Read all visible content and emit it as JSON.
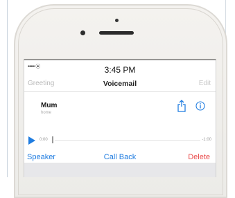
{
  "status_bar": {
    "signal": "••••• ⦿",
    "time": "3:45 PM"
  },
  "nav": {
    "left": "Greeting",
    "title": "Voicemail",
    "right": "Edit"
  },
  "voicemail": {
    "name": "Mum",
    "label": "home"
  },
  "playback": {
    "elapsed": "0:00",
    "remaining": "-1:00",
    "progress": 0.0
  },
  "actions": {
    "speaker": "Speaker",
    "call_back": "Call Back",
    "delete": "Delete"
  },
  "colors": {
    "accent": "#1f7ce0",
    "destructive": "#ea4e4e"
  },
  "icons": {
    "share": "share-icon",
    "info": "info-icon",
    "play": "play-icon"
  }
}
